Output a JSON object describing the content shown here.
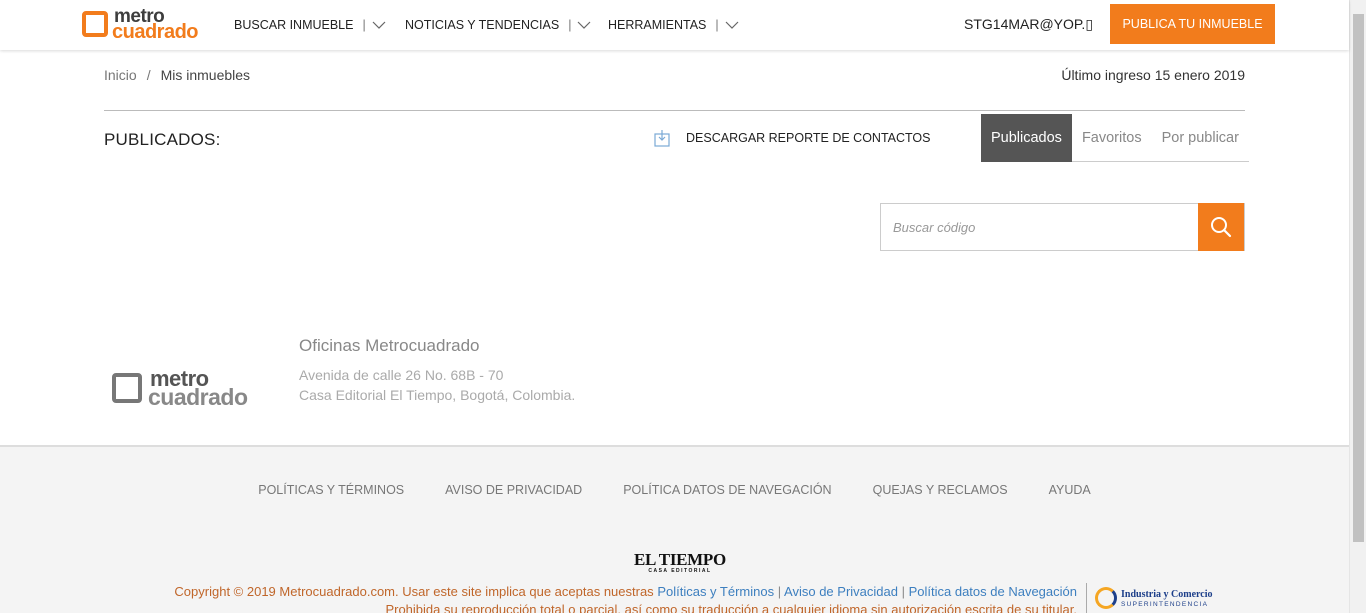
{
  "header": {
    "logo_top": "metro",
    "logo_bottom": "cuadrado",
    "nav": [
      {
        "label": "BUSCAR INMUEBLE",
        "sep": "|"
      },
      {
        "label": "NOTICIAS Y TENDENCIAS",
        "sep": "|"
      },
      {
        "label": "HERRAMIENTAS",
        "sep": "|"
      }
    ],
    "user": "STG14MAR@YOP.▯",
    "publish_label": "PUBLICA TU INMUEBLE"
  },
  "breadcrumb": {
    "home": "Inicio",
    "sep": "/",
    "current": "Mis inmuebles"
  },
  "last_login": "Último ingreso 15 enero 2019",
  "section_title": "PUBLICADOS:",
  "download_label": "DESCARGAR REPORTE DE CONTACTOS",
  "tabs": [
    {
      "label": "Publicados",
      "active": true
    },
    {
      "label": "Favoritos",
      "active": false
    },
    {
      "label": "Por publicar",
      "active": false
    }
  ],
  "search": {
    "placeholder": "Buscar código"
  },
  "office": {
    "logo_top": "metro",
    "logo_bottom": "cuadrado",
    "title": "Oficinas Metrocuadrado",
    "address": "Avenida de calle 26 No. 68B - 70",
    "city": "Casa Editorial El Tiempo, Bogotá, Colombia."
  },
  "footer": {
    "links": [
      "POLÍTICAS Y TÉRMINOS",
      "AVISO DE PRIVACIDAD",
      "POLÍTICA DATOS DE NAVEGACIÓN",
      "QUEJAS Y RECLAMOS",
      "AYUDA"
    ],
    "brand": "EL TIEMPO",
    "brand_sub": "CASA EDITORIAL",
    "copyright": "Copyright © 2019 Metrocuadrado.com. Usar este site implica que aceptas nuestras",
    "copy_link1": "Políticas y Términos",
    "copy_link2": "Aviso de Privacidad",
    "copy_link3": "Política datos de Navegación",
    "pipe": "|",
    "rights": "Prohibida su reproducción total o parcial, así como su traducción a cualquier idioma sin autorización escrita de su titular.",
    "sic_line1": "Industria y Comercio",
    "sic_line2": "SUPERINTENDENCIA"
  },
  "colors": {
    "accent": "#f27c1c",
    "active_tab": "#555555",
    "link": "#3d7fbf"
  }
}
